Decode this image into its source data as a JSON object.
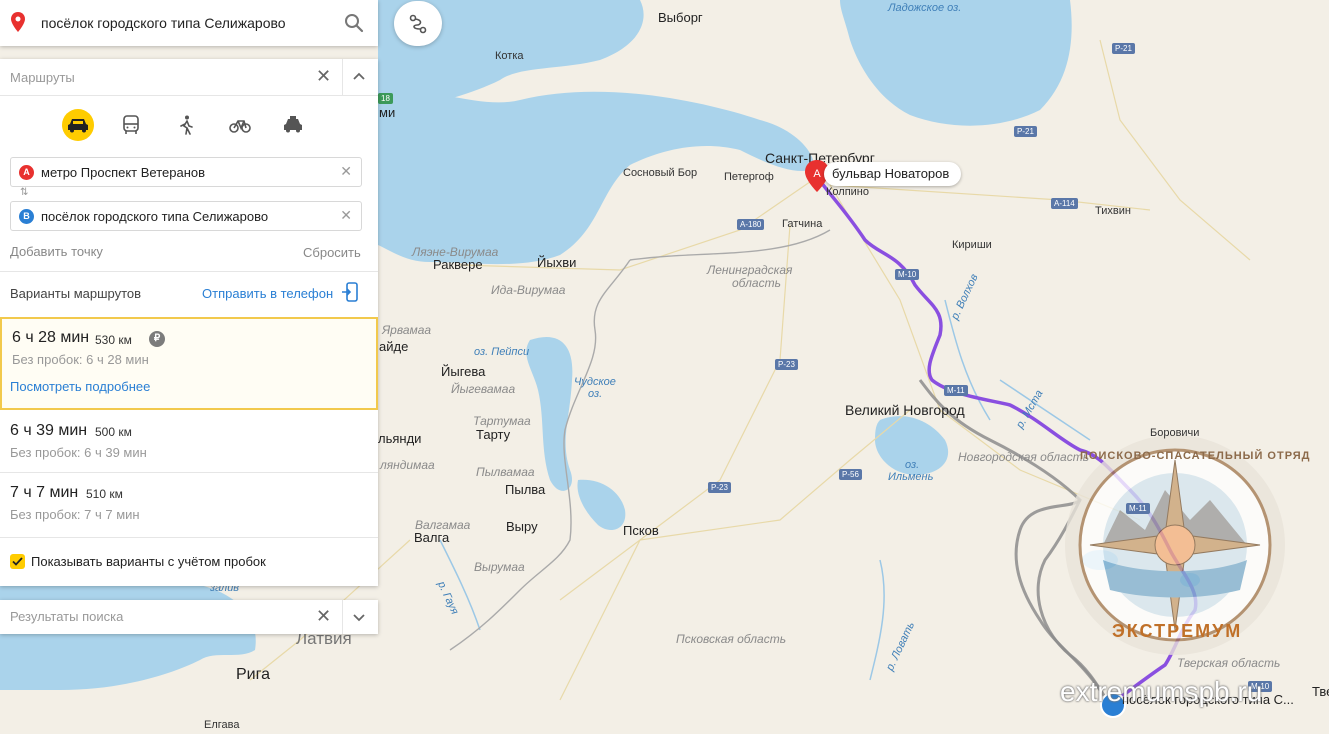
{
  "search": {
    "query": "посёлок городского типа Селижарово"
  },
  "routes_panel": {
    "title": "Маршруты",
    "point_a": {
      "badge": "A",
      "value": "метро Проспект Ветеранов"
    },
    "point_b": {
      "badge": "B",
      "value": "посёлок городского типа Селижарово"
    },
    "add_point": "Добавить точку",
    "reset": "Сбросить",
    "variants_label": "Варианты маршрутов",
    "send_to_phone": "Отправить в телефон",
    "routes": [
      {
        "time": "6 ч 28 мин",
        "distance": "530 км",
        "toll": "₽",
        "no_traffic": "Без пробок: 6 ч 28 мин",
        "details_link": "Посмотреть подробнее"
      },
      {
        "time": "6 ч 39 мин",
        "distance": "500 км",
        "no_traffic": "Без пробок: 6 ч 39 мин"
      },
      {
        "time": "7 ч 7 мин",
        "distance": "510 км",
        "no_traffic": "Без пробок: 7 ч 7 мин"
      }
    ],
    "traffic_checkbox": "Показывать варианты с учётом пробок",
    "traffic_checked": true
  },
  "results_bar": {
    "title": "Результаты поиска"
  },
  "map": {
    "pin_a_label": "бульвар Новаторов",
    "pin_b_label": "посёлок городского типа С...",
    "pin_a_badge": "A",
    "watermark": {
      "arc_top": "ПОИСКОВО-СПАСАТЕЛЬНЫЙ ОТРЯД",
      "arc_bottom": "ЭКСТРЕМУМ",
      "url": "extremumspb.ru"
    },
    "labels": {
      "vyborg": "Выборг",
      "kotka": "Котка",
      "ladoga": "Ладожское оз.",
      "spb": "Санкт-Петербург",
      "sosnovy_bor": "Сосновый Бор",
      "petergof": "Петергоф",
      "kolpino": "Колпино",
      "gatchina": "Гатчина",
      "tikhvin": "Тихвин",
      "kirishi": "Кириши",
      "lyanne_virumaa": "Ляэне-Вирумаа",
      "rakvere": "Раквере",
      "yykhvi": "Йыхви",
      "ida_virumaa": "Ида-Вирумаа",
      "len_obl_1": "Ленинградская",
      "len_obl_2": "область",
      "r_volkhov": "р. Волхов",
      "r_msta": "р. Мста",
      "yarvamaa": "Ярвамаа",
      "paide": "Пайде",
      "oz_peipsi": "оз. Пейпси",
      "chudskoe_1": "Чудское",
      "chudskoe_2": "оз.",
      "yygeva": "Йыгева",
      "yygevamaa": "Йыгевамаа",
      "tartumaa": "Тартумаа",
      "tartu": "Тарту",
      "vilyandi": "Вильянди",
      "vilyandimaa": "Вильяндимаа",
      "velikiy_novgorod": "Великий Новгород",
      "borovichi": "Боровичи",
      "novgorod_obl": "Новгородская область",
      "oz_ilmen_1": "оз.",
      "oz_ilmen_2": "Ильмень",
      "polvamaa": "Пылвамаа",
      "polva": "Пылва",
      "valgamaa": "Валгамаа",
      "valga": "Валга",
      "vyru": "Выру",
      "vyrumaa": "Вырумаа",
      "pskov": "Псков",
      "r_gauya": "р. Гауя",
      "pskov_obl": "Псковская область",
      "r_lovat": "р. Ловать",
      "tver_obl": "Тверская область",
      "zaliv": "залив",
      "latvia": "Латвия",
      "riga": "Рига",
      "yelgava": "Елгава",
      "tv": "Тве",
      "mi": "ми",
      "ai": "айде",
      "lyandi": "льянди",
      "lyandimaa": "ляндимаа"
    },
    "roads": {
      "a180": "А-180",
      "a114": "А-114",
      "r21": "Р-21",
      "r21b": "Р-21",
      "m10": "М-10",
      "m10b": "М-11",
      "r23": "Р-23",
      "r23b": "Р-23",
      "r56": "Р-56",
      "m10c": "М-10",
      "m11": "М-11",
      "e18": "18"
    },
    "colors": {
      "water": "#aad3eb",
      "land": "#f3efe6",
      "route_main": "#8a4fe0",
      "route_alt": "#8c8c8c",
      "pin_a": "#e8312f",
      "pin_b": "#2a7fd4",
      "accent": "#ffcc00"
    }
  }
}
